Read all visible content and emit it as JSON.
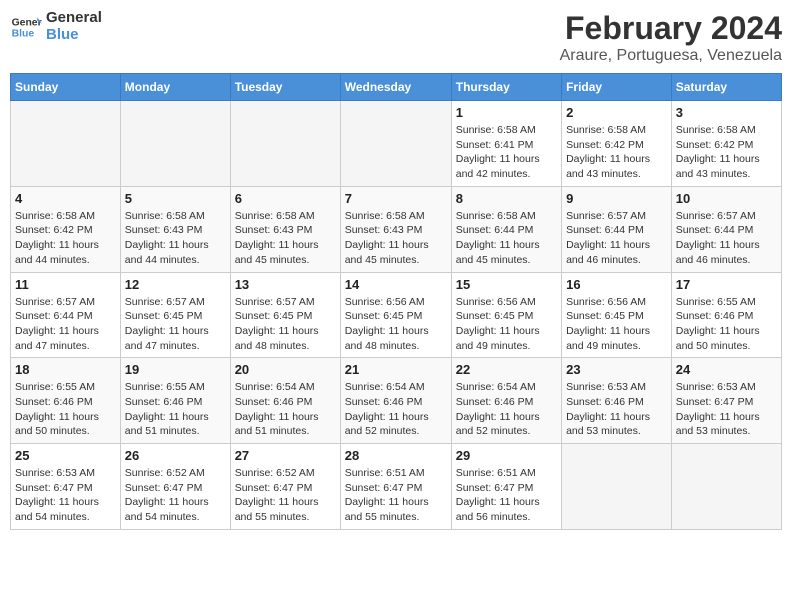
{
  "logo": {
    "text_general": "General",
    "text_blue": "Blue"
  },
  "title": "February 2024",
  "subtitle": "Araure, Portuguesa, Venezuela",
  "weekdays": [
    "Sunday",
    "Monday",
    "Tuesday",
    "Wednesday",
    "Thursday",
    "Friday",
    "Saturday"
  ],
  "weeks": [
    [
      {
        "day": "",
        "info": ""
      },
      {
        "day": "",
        "info": ""
      },
      {
        "day": "",
        "info": ""
      },
      {
        "day": "",
        "info": ""
      },
      {
        "day": "1",
        "info": "Sunrise: 6:58 AM\nSunset: 6:41 PM\nDaylight: 11 hours and 42 minutes."
      },
      {
        "day": "2",
        "info": "Sunrise: 6:58 AM\nSunset: 6:42 PM\nDaylight: 11 hours and 43 minutes."
      },
      {
        "day": "3",
        "info": "Sunrise: 6:58 AM\nSunset: 6:42 PM\nDaylight: 11 hours and 43 minutes."
      }
    ],
    [
      {
        "day": "4",
        "info": "Sunrise: 6:58 AM\nSunset: 6:42 PM\nDaylight: 11 hours and 44 minutes."
      },
      {
        "day": "5",
        "info": "Sunrise: 6:58 AM\nSunset: 6:43 PM\nDaylight: 11 hours and 44 minutes."
      },
      {
        "day": "6",
        "info": "Sunrise: 6:58 AM\nSunset: 6:43 PM\nDaylight: 11 hours and 45 minutes."
      },
      {
        "day": "7",
        "info": "Sunrise: 6:58 AM\nSunset: 6:43 PM\nDaylight: 11 hours and 45 minutes."
      },
      {
        "day": "8",
        "info": "Sunrise: 6:58 AM\nSunset: 6:44 PM\nDaylight: 11 hours and 45 minutes."
      },
      {
        "day": "9",
        "info": "Sunrise: 6:57 AM\nSunset: 6:44 PM\nDaylight: 11 hours and 46 minutes."
      },
      {
        "day": "10",
        "info": "Sunrise: 6:57 AM\nSunset: 6:44 PM\nDaylight: 11 hours and 46 minutes."
      }
    ],
    [
      {
        "day": "11",
        "info": "Sunrise: 6:57 AM\nSunset: 6:44 PM\nDaylight: 11 hours and 47 minutes."
      },
      {
        "day": "12",
        "info": "Sunrise: 6:57 AM\nSunset: 6:45 PM\nDaylight: 11 hours and 47 minutes."
      },
      {
        "day": "13",
        "info": "Sunrise: 6:57 AM\nSunset: 6:45 PM\nDaylight: 11 hours and 48 minutes."
      },
      {
        "day": "14",
        "info": "Sunrise: 6:56 AM\nSunset: 6:45 PM\nDaylight: 11 hours and 48 minutes."
      },
      {
        "day": "15",
        "info": "Sunrise: 6:56 AM\nSunset: 6:45 PM\nDaylight: 11 hours and 49 minutes."
      },
      {
        "day": "16",
        "info": "Sunrise: 6:56 AM\nSunset: 6:45 PM\nDaylight: 11 hours and 49 minutes."
      },
      {
        "day": "17",
        "info": "Sunrise: 6:55 AM\nSunset: 6:46 PM\nDaylight: 11 hours and 50 minutes."
      }
    ],
    [
      {
        "day": "18",
        "info": "Sunrise: 6:55 AM\nSunset: 6:46 PM\nDaylight: 11 hours and 50 minutes."
      },
      {
        "day": "19",
        "info": "Sunrise: 6:55 AM\nSunset: 6:46 PM\nDaylight: 11 hours and 51 minutes."
      },
      {
        "day": "20",
        "info": "Sunrise: 6:54 AM\nSunset: 6:46 PM\nDaylight: 11 hours and 51 minutes."
      },
      {
        "day": "21",
        "info": "Sunrise: 6:54 AM\nSunset: 6:46 PM\nDaylight: 11 hours and 52 minutes."
      },
      {
        "day": "22",
        "info": "Sunrise: 6:54 AM\nSunset: 6:46 PM\nDaylight: 11 hours and 52 minutes."
      },
      {
        "day": "23",
        "info": "Sunrise: 6:53 AM\nSunset: 6:46 PM\nDaylight: 11 hours and 53 minutes."
      },
      {
        "day": "24",
        "info": "Sunrise: 6:53 AM\nSunset: 6:47 PM\nDaylight: 11 hours and 53 minutes."
      }
    ],
    [
      {
        "day": "25",
        "info": "Sunrise: 6:53 AM\nSunset: 6:47 PM\nDaylight: 11 hours and 54 minutes."
      },
      {
        "day": "26",
        "info": "Sunrise: 6:52 AM\nSunset: 6:47 PM\nDaylight: 11 hours and 54 minutes."
      },
      {
        "day": "27",
        "info": "Sunrise: 6:52 AM\nSunset: 6:47 PM\nDaylight: 11 hours and 55 minutes."
      },
      {
        "day": "28",
        "info": "Sunrise: 6:51 AM\nSunset: 6:47 PM\nDaylight: 11 hours and 55 minutes."
      },
      {
        "day": "29",
        "info": "Sunrise: 6:51 AM\nSunset: 6:47 PM\nDaylight: 11 hours and 56 minutes."
      },
      {
        "day": "",
        "info": ""
      },
      {
        "day": "",
        "info": ""
      }
    ]
  ]
}
